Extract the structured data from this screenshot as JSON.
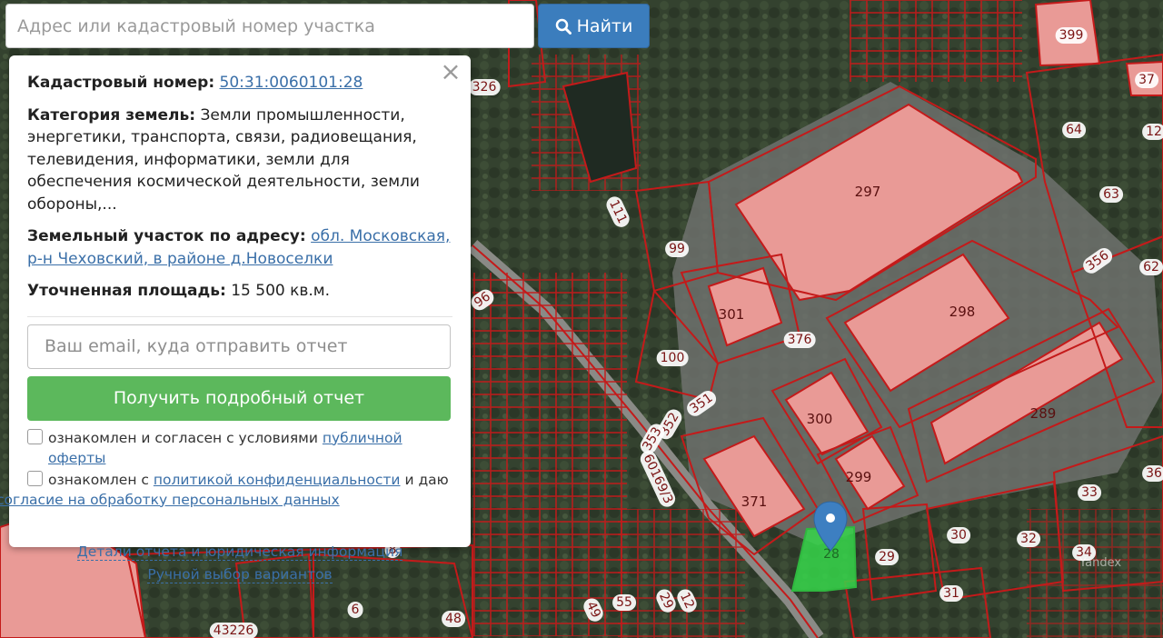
{
  "search": {
    "placeholder": "Адрес или кадастровый номер участка",
    "button_label": "Найти"
  },
  "card": {
    "cadastral_label": "Кадастровый номер:",
    "cadastral_number": "50:31:0060101:28",
    "category_label": "Категория земель:",
    "category_value": "Земли промышленности, энергетики, транспорта, связи, радиовещания, телевидения, информатики, земли для обеспечения космической деятельности, земли обороны,...",
    "address_label": "Земельный участок по адресу:",
    "address_value": "обл. Московская, р-н Чеховский, в районе д.Новоселки",
    "area_label": "Уточненная площадь:",
    "area_value": "15 500 кв.м.",
    "email_placeholder": "Ваш email, куда отправить отчет",
    "report_button": "Получить подробный отчет",
    "consent1_text": "ознакомлен и согласен с условиями",
    "consent1_link": "публичной оферты",
    "consent2_text": "ознакомлен с",
    "consent2_link": "политикой конфиденциальности",
    "consent2_mid": "и даю",
    "consent2_link2": "согласие на обработку персональных данных",
    "details_link": "Детали отчета и юридическая информация",
    "manual_link": "Ручной выбор вариантов"
  },
  "map": {
    "watermark": "Yandex",
    "labels": [
      {
        "text": "399"
      },
      {
        "text": "37"
      },
      {
        "text": "326"
      },
      {
        "text": "64"
      },
      {
        "text": "12"
      },
      {
        "text": "297"
      },
      {
        "text": "63"
      },
      {
        "text": "111"
      },
      {
        "text": "99"
      },
      {
        "text": "356"
      },
      {
        "text": "62"
      },
      {
        "text": "96"
      },
      {
        "text": "301"
      },
      {
        "text": "298"
      },
      {
        "text": "376"
      },
      {
        "text": "100"
      },
      {
        "text": "351"
      },
      {
        "text": "300"
      },
      {
        "text": "289"
      },
      {
        "text": "352"
      },
      {
        "text": "353"
      },
      {
        "text": "60169/3"
      },
      {
        "text": "299"
      },
      {
        "text": "36"
      },
      {
        "text": "371"
      },
      {
        "text": "33"
      },
      {
        "text": "30"
      },
      {
        "text": "32"
      },
      {
        "text": "34"
      },
      {
        "text": "29"
      },
      {
        "text": "28"
      },
      {
        "text": "31"
      },
      {
        "text": "6"
      },
      {
        "text": "55"
      },
      {
        "text": "29"
      },
      {
        "text": "12"
      },
      {
        "text": "49"
      },
      {
        "text": "48"
      },
      {
        "text": "43226"
      },
      {
        "text": "8"
      }
    ]
  },
  "colors": {
    "parcel_border": "#c41a1a",
    "building_fill": "#e99a96",
    "selected_parcel": "#36d64a",
    "marker": "#3d7fc1",
    "primary_button": "#3b7dbd",
    "report_button": "#5cb85c"
  }
}
